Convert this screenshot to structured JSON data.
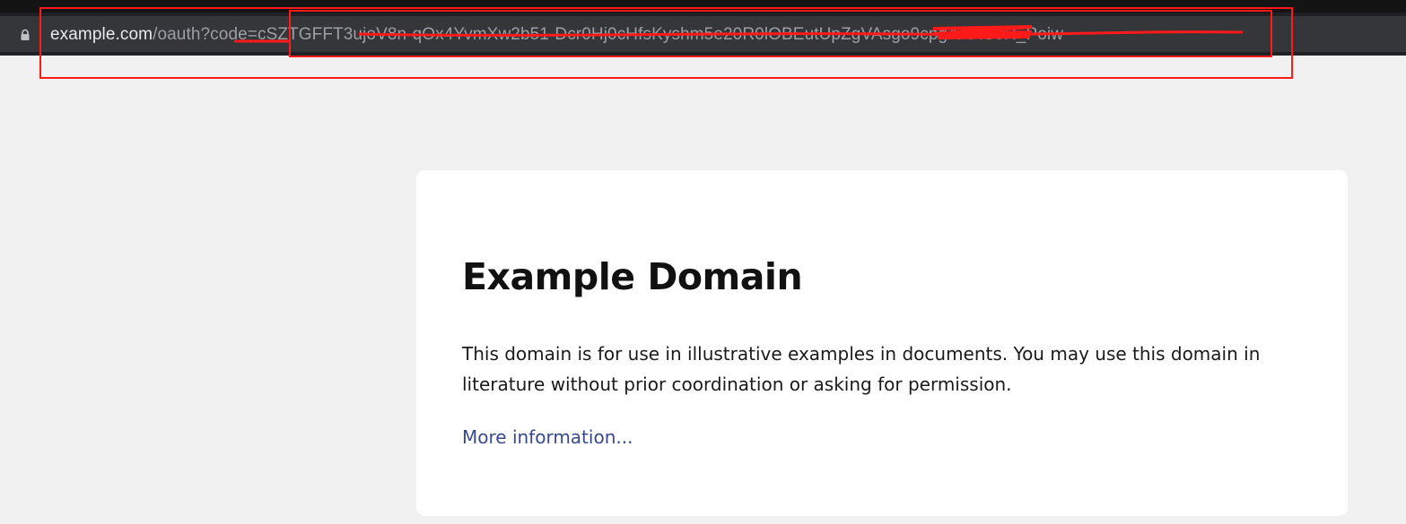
{
  "browser": {
    "url": {
      "domain": "example.com",
      "path": "/oauth?code=cSZTGFFT3ujoV8n-qOx4YvmXw2b51-Dcr0Hj0cHfsKyshm5e20R0lOBEutUpZg",
      "tail": "VAsgo9cpgAAAGJR_Poiw"
    },
    "lock_icon": "lock-icon"
  },
  "page": {
    "title": "Example Domain",
    "description": "This domain is for use in illustrative examples in documents. You may use this domain in literature without prior coordination or asking for permission.",
    "link_text": "More information..."
  },
  "colors": {
    "page_background": "#f2f1f2",
    "card_background": "#ffffff",
    "link": "#38488f",
    "annotation_red": "#ff0000",
    "address_bar": "#35363a"
  }
}
